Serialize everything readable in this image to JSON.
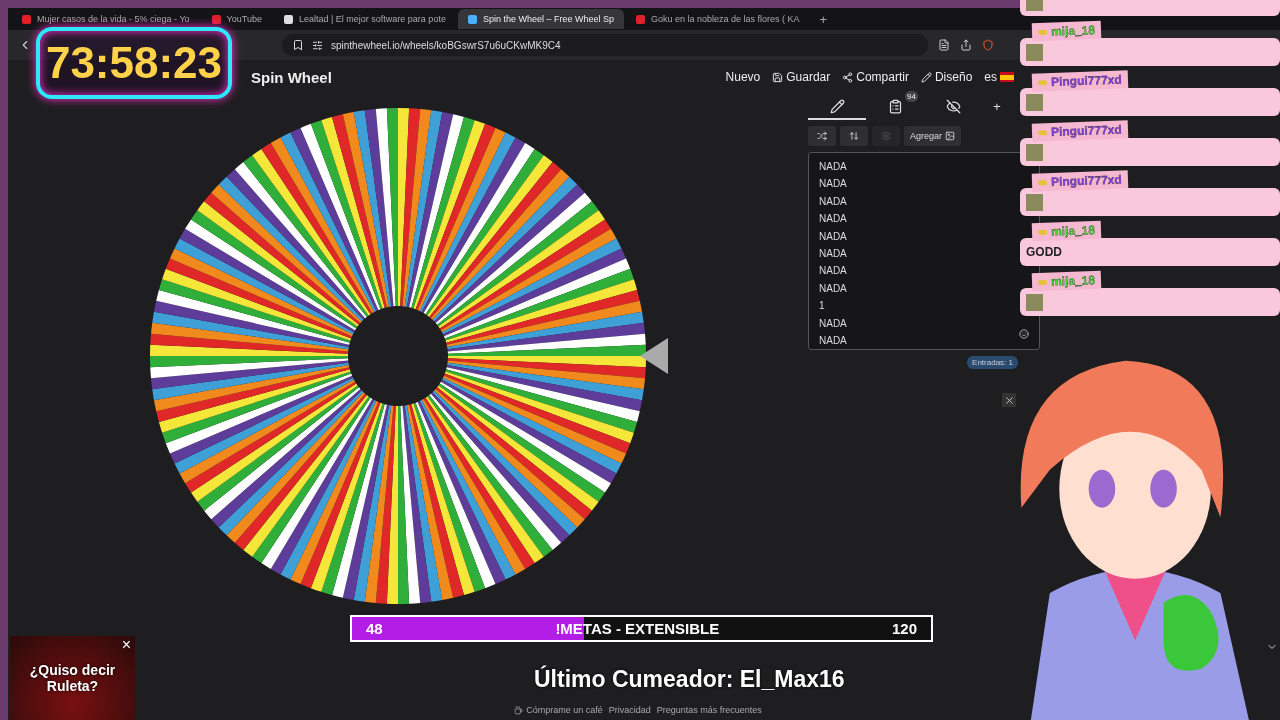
{
  "browser": {
    "tabs": [
      {
        "title": "Mujer casos de la vida - 5% ciega - Yo",
        "selected": false
      },
      {
        "title": "YouTube",
        "selected": false
      },
      {
        "title": "Lealtad | El mejor software para pote",
        "selected": false
      },
      {
        "title": "Spin the Wheel – Free Wheel Sp",
        "selected": true
      },
      {
        "title": "Goku en la nobleza de las flores ( KA",
        "selected": false
      }
    ],
    "new_tab": "+",
    "url": "spinthewheel.io/wheels/koBGswrS7u6uCKwMK9C4"
  },
  "site": {
    "logo": "Spin Wheel",
    "nav": [
      {
        "label": "Nuevo",
        "kind": "new"
      },
      {
        "label": "Guardar",
        "kind": "save"
      },
      {
        "label": "Compartir",
        "kind": "share"
      },
      {
        "label": "Diseño",
        "kind": "design"
      }
    ],
    "language": "es"
  },
  "editor": {
    "tabs": [
      {
        "kind": "edit",
        "selected": true
      },
      {
        "kind": "list",
        "selected": false,
        "badge": "94"
      },
      {
        "kind": "hide",
        "selected": false
      }
    ],
    "add_symbol": "+",
    "tools": [
      {
        "kind": "shuffle",
        "disabled": false
      },
      {
        "kind": "sort",
        "disabled": false
      },
      {
        "kind": "settings",
        "disabled": true
      },
      {
        "kind": "add",
        "label": "Agregar",
        "disabled": false
      }
    ],
    "entries": [
      "NADA",
      "NADA",
      "NADA",
      "NADA",
      "NADA",
      "NADA",
      "NADA",
      "NADA",
      "1",
      "NADA",
      "NADA"
    ],
    "entries_count": "Entradas: 1"
  },
  "footer": [
    "Cómprame un café",
    "Privacidad",
    "Preguntas más frecuentes"
  ],
  "overlay": {
    "timer": "73:58:23",
    "goal": {
      "current": "48",
      "title": "!METAS - EXTENSIBLE",
      "target": "120",
      "level": 0.4
    },
    "last_cumeador": "Último Cumeador: El_Max16",
    "ad": {
      "text": "¿Quiso decir Ruleta?",
      "close": "×"
    },
    "chat": [
      {
        "kind": "emote"
      },
      {
        "user": "mija_18",
        "color": "#3ddc2f",
        "kind": "emote"
      },
      {
        "user": "Pingui777xd",
        "color": "#8a3cf0",
        "kind": "emote"
      },
      {
        "user": "Pingui777xd",
        "color": "#8a3cf0",
        "kind": "emote"
      },
      {
        "user": "Pingui777xd",
        "color": "#8a3cf0",
        "kind": "emote"
      },
      {
        "user": "mija_18",
        "color": "#3ddc2f",
        "kind": "text",
        "text": "GODD"
      },
      {
        "user": "mija_18",
        "color": "#3ddc2f",
        "kind": "emote"
      }
    ]
  }
}
